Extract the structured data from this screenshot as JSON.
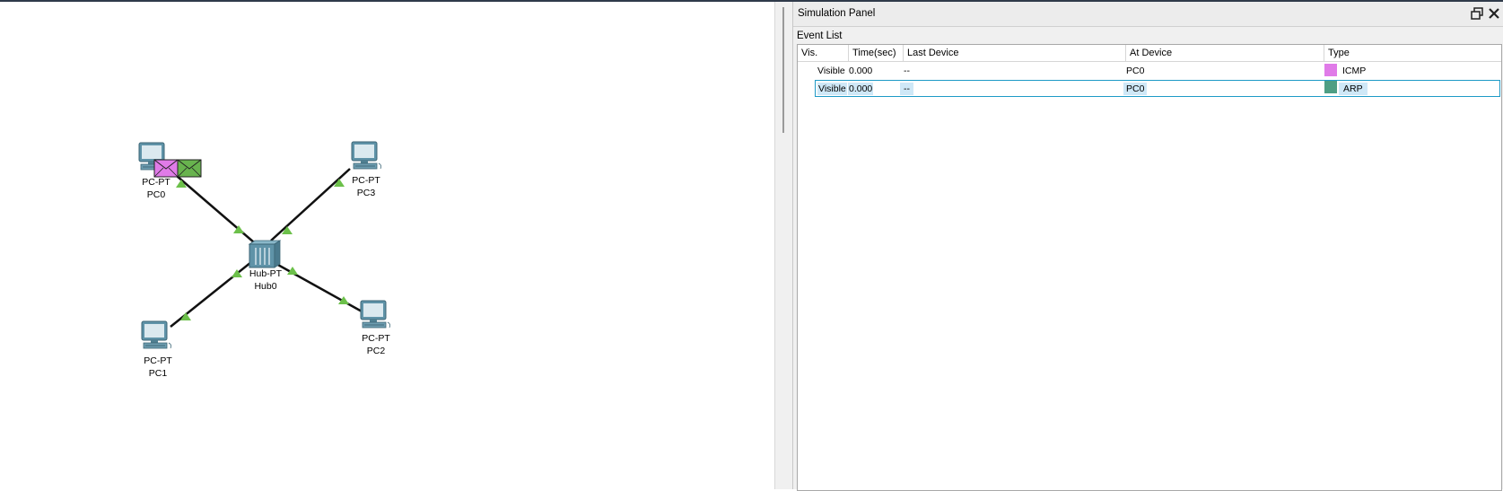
{
  "topology": {
    "devices": [
      {
        "id": "pc0",
        "model": "PC-PT",
        "name": "PC0"
      },
      {
        "id": "pc3",
        "model": "PC-PT",
        "name": "PC3"
      },
      {
        "id": "hub0",
        "model": "Hub-PT",
        "name": "Hub0"
      },
      {
        "id": "pc1",
        "model": "PC-PT",
        "name": "PC1"
      },
      {
        "id": "pc2",
        "model": "PC-PT",
        "name": "PC2"
      }
    ]
  },
  "panel": {
    "title": "Simulation Panel",
    "event_list_label": "Event List",
    "columns": [
      "Vis.",
      "Time(sec)",
      "Last Device",
      "At Device",
      "Type"
    ],
    "events": [
      {
        "vis": "Visible",
        "time": "0.000",
        "last_device": "--",
        "at_device": "PC0",
        "type": "ICMP",
        "color": "#e07be8",
        "selected": false
      },
      {
        "vis": "Visible",
        "time": "0.000",
        "last_device": "--",
        "at_device": "PC0",
        "type": "ARP",
        "color": "#4e9e84",
        "selected": true
      }
    ]
  },
  "colors": {
    "link": "#111111",
    "port_up": "#6cc04a",
    "icmp_envelope": "#e07be8",
    "arp_envelope": "#68b34e",
    "selection_border": "#1e9ac6"
  },
  "icons": [
    "restore-icon",
    "close-icon",
    "pc-icon",
    "hub-icon",
    "envelope-icon"
  ]
}
